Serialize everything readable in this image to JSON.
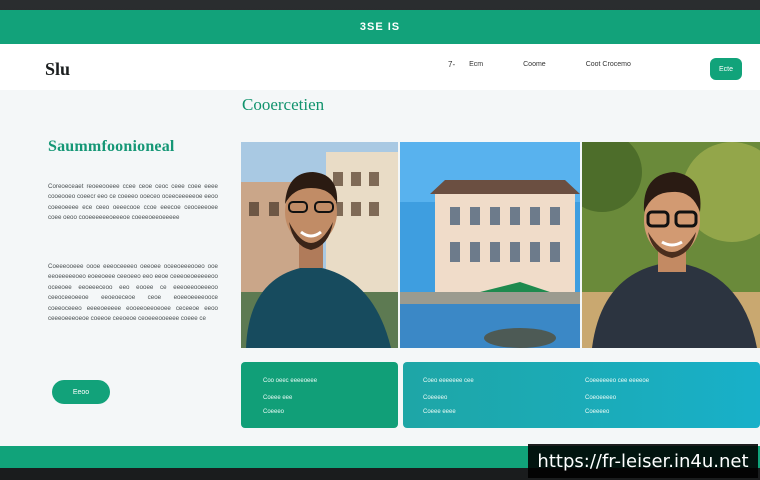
{
  "header": {
    "title": "3SE IS"
  },
  "nav": {
    "logo": "Slu",
    "links": [
      "7-",
      "Ecm",
      "Coome",
      "Coot Crocemo"
    ],
    "cta_label": "Ecte"
  },
  "hero": {
    "section_heading": "Cooercetien",
    "main_heading": "Saummfoonioneal",
    "paragraph_1": "Coreoeceaet reoeeooeee ccee ceoe ceoc ceee coee eeee cooeooeo coeecr eeo ce coeeeo ooeceo oceeceeeeeoe eeoo coeeoeeee ece ceeo oeeecooe ccoe eeecoe ceoceeeoee coee oeoo cooeeeeeeoeeeoe coeeeoeeoeeeee",
    "paragraph_2": "Coeeeooeee oooe eeeoceeeeo oeeoee oceeoeeeooeo ooe eeoeeeeeoeo eoeeoeee ceeoeeo eeo eeoe ceeeoeoeeeeeoo oceeoee eeoeeeceoo eeo eooee ce eeeoeeooeeeoo ceeoceeoeeoe eeoeoeceoe ceoe eoeeoeeeeooce coeeoceeeo eeeeoeeeee eooeeoeeoeoee ceceeoe eeoo ceeeoeeeoeoe coeeoe ceeoeoe ceoeeeooeeee coeee ce",
    "button_label": "Eeoo"
  },
  "cards": {
    "green": {
      "lines": [
        "Coo oeec eeeeoeee",
        "Coeee eee",
        "Coeeeo"
      ]
    },
    "blue": {
      "left_lines": [
        "Coeo eeeeeee cee",
        "Coeeeeo",
        "Coeee eeee"
      ],
      "right_lines": [
        "Coeeeeeeo cee eeeeoe",
        "Coeoeeeeo",
        "Coeeeeo"
      ]
    }
  },
  "watermark": "https://fr-leiser.in4u.net",
  "colors": {
    "accent": "#12a27a",
    "blue_card": "#18b0c9",
    "page": "#f4f7f8"
  }
}
